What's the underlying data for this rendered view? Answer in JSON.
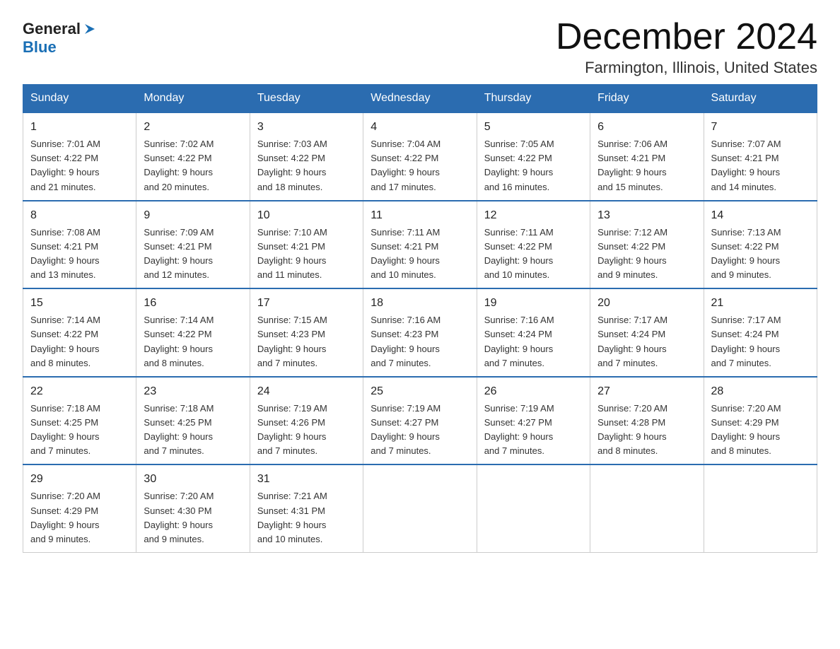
{
  "logo": {
    "general": "General",
    "blue": "Blue"
  },
  "title": {
    "month": "December 2024",
    "location": "Farmington, Illinois, United States"
  },
  "days_header": [
    "Sunday",
    "Monday",
    "Tuesday",
    "Wednesday",
    "Thursday",
    "Friday",
    "Saturday"
  ],
  "weeks": [
    [
      {
        "day": "1",
        "sunrise": "7:01 AM",
        "sunset": "4:22 PM",
        "daylight": "9 hours and 21 minutes."
      },
      {
        "day": "2",
        "sunrise": "7:02 AM",
        "sunset": "4:22 PM",
        "daylight": "9 hours and 20 minutes."
      },
      {
        "day": "3",
        "sunrise": "7:03 AM",
        "sunset": "4:22 PM",
        "daylight": "9 hours and 18 minutes."
      },
      {
        "day": "4",
        "sunrise": "7:04 AM",
        "sunset": "4:22 PM",
        "daylight": "9 hours and 17 minutes."
      },
      {
        "day": "5",
        "sunrise": "7:05 AM",
        "sunset": "4:22 PM",
        "daylight": "9 hours and 16 minutes."
      },
      {
        "day": "6",
        "sunrise": "7:06 AM",
        "sunset": "4:21 PM",
        "daylight": "9 hours and 15 minutes."
      },
      {
        "day": "7",
        "sunrise": "7:07 AM",
        "sunset": "4:21 PM",
        "daylight": "9 hours and 14 minutes."
      }
    ],
    [
      {
        "day": "8",
        "sunrise": "7:08 AM",
        "sunset": "4:21 PM",
        "daylight": "9 hours and 13 minutes."
      },
      {
        "day": "9",
        "sunrise": "7:09 AM",
        "sunset": "4:21 PM",
        "daylight": "9 hours and 12 minutes."
      },
      {
        "day": "10",
        "sunrise": "7:10 AM",
        "sunset": "4:21 PM",
        "daylight": "9 hours and 11 minutes."
      },
      {
        "day": "11",
        "sunrise": "7:11 AM",
        "sunset": "4:21 PM",
        "daylight": "9 hours and 10 minutes."
      },
      {
        "day": "12",
        "sunrise": "7:11 AM",
        "sunset": "4:22 PM",
        "daylight": "9 hours and 10 minutes."
      },
      {
        "day": "13",
        "sunrise": "7:12 AM",
        "sunset": "4:22 PM",
        "daylight": "9 hours and 9 minutes."
      },
      {
        "day": "14",
        "sunrise": "7:13 AM",
        "sunset": "4:22 PM",
        "daylight": "9 hours and 9 minutes."
      }
    ],
    [
      {
        "day": "15",
        "sunrise": "7:14 AM",
        "sunset": "4:22 PM",
        "daylight": "9 hours and 8 minutes."
      },
      {
        "day": "16",
        "sunrise": "7:14 AM",
        "sunset": "4:22 PM",
        "daylight": "9 hours and 8 minutes."
      },
      {
        "day": "17",
        "sunrise": "7:15 AM",
        "sunset": "4:23 PM",
        "daylight": "9 hours and 7 minutes."
      },
      {
        "day": "18",
        "sunrise": "7:16 AM",
        "sunset": "4:23 PM",
        "daylight": "9 hours and 7 minutes."
      },
      {
        "day": "19",
        "sunrise": "7:16 AM",
        "sunset": "4:24 PM",
        "daylight": "9 hours and 7 minutes."
      },
      {
        "day": "20",
        "sunrise": "7:17 AM",
        "sunset": "4:24 PM",
        "daylight": "9 hours and 7 minutes."
      },
      {
        "day": "21",
        "sunrise": "7:17 AM",
        "sunset": "4:24 PM",
        "daylight": "9 hours and 7 minutes."
      }
    ],
    [
      {
        "day": "22",
        "sunrise": "7:18 AM",
        "sunset": "4:25 PM",
        "daylight": "9 hours and 7 minutes."
      },
      {
        "day": "23",
        "sunrise": "7:18 AM",
        "sunset": "4:25 PM",
        "daylight": "9 hours and 7 minutes."
      },
      {
        "day": "24",
        "sunrise": "7:19 AM",
        "sunset": "4:26 PM",
        "daylight": "9 hours and 7 minutes."
      },
      {
        "day": "25",
        "sunrise": "7:19 AM",
        "sunset": "4:27 PM",
        "daylight": "9 hours and 7 minutes."
      },
      {
        "day": "26",
        "sunrise": "7:19 AM",
        "sunset": "4:27 PM",
        "daylight": "9 hours and 7 minutes."
      },
      {
        "day": "27",
        "sunrise": "7:20 AM",
        "sunset": "4:28 PM",
        "daylight": "9 hours and 8 minutes."
      },
      {
        "day": "28",
        "sunrise": "7:20 AM",
        "sunset": "4:29 PM",
        "daylight": "9 hours and 8 minutes."
      }
    ],
    [
      {
        "day": "29",
        "sunrise": "7:20 AM",
        "sunset": "4:29 PM",
        "daylight": "9 hours and 9 minutes."
      },
      {
        "day": "30",
        "sunrise": "7:20 AM",
        "sunset": "4:30 PM",
        "daylight": "9 hours and 9 minutes."
      },
      {
        "day": "31",
        "sunrise": "7:21 AM",
        "sunset": "4:31 PM",
        "daylight": "9 hours and 10 minutes."
      },
      null,
      null,
      null,
      null
    ]
  ],
  "labels": {
    "sunrise": "Sunrise:",
    "sunset": "Sunset:",
    "daylight": "Daylight:"
  }
}
